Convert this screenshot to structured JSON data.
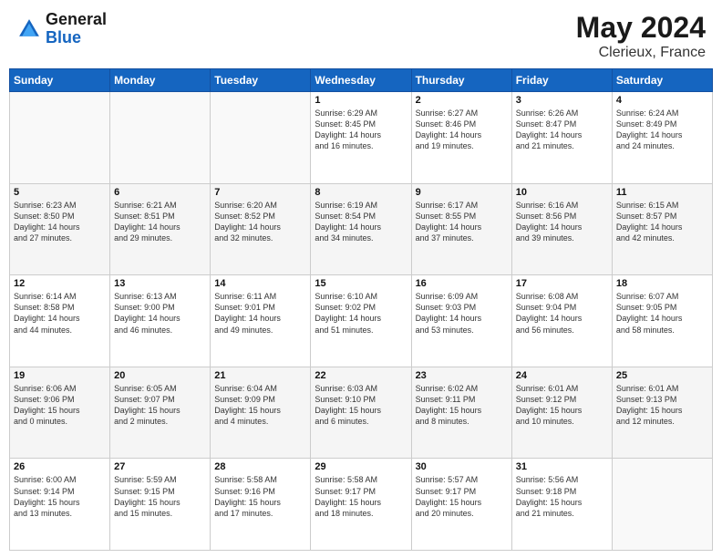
{
  "header": {
    "logo_general": "General",
    "logo_blue": "Blue",
    "month": "May 2024",
    "location": "Clerieux, France"
  },
  "weekdays": [
    "Sunday",
    "Monday",
    "Tuesday",
    "Wednesday",
    "Thursday",
    "Friday",
    "Saturday"
  ],
  "rows": [
    [
      {
        "day": "",
        "text": ""
      },
      {
        "day": "",
        "text": ""
      },
      {
        "day": "",
        "text": ""
      },
      {
        "day": "1",
        "text": "Sunrise: 6:29 AM\nSunset: 8:45 PM\nDaylight: 14 hours\nand 16 minutes."
      },
      {
        "day": "2",
        "text": "Sunrise: 6:27 AM\nSunset: 8:46 PM\nDaylight: 14 hours\nand 19 minutes."
      },
      {
        "day": "3",
        "text": "Sunrise: 6:26 AM\nSunset: 8:47 PM\nDaylight: 14 hours\nand 21 minutes."
      },
      {
        "day": "4",
        "text": "Sunrise: 6:24 AM\nSunset: 8:49 PM\nDaylight: 14 hours\nand 24 minutes."
      }
    ],
    [
      {
        "day": "5",
        "text": "Sunrise: 6:23 AM\nSunset: 8:50 PM\nDaylight: 14 hours\nand 27 minutes."
      },
      {
        "day": "6",
        "text": "Sunrise: 6:21 AM\nSunset: 8:51 PM\nDaylight: 14 hours\nand 29 minutes."
      },
      {
        "day": "7",
        "text": "Sunrise: 6:20 AM\nSunset: 8:52 PM\nDaylight: 14 hours\nand 32 minutes."
      },
      {
        "day": "8",
        "text": "Sunrise: 6:19 AM\nSunset: 8:54 PM\nDaylight: 14 hours\nand 34 minutes."
      },
      {
        "day": "9",
        "text": "Sunrise: 6:17 AM\nSunset: 8:55 PM\nDaylight: 14 hours\nand 37 minutes."
      },
      {
        "day": "10",
        "text": "Sunrise: 6:16 AM\nSunset: 8:56 PM\nDaylight: 14 hours\nand 39 minutes."
      },
      {
        "day": "11",
        "text": "Sunrise: 6:15 AM\nSunset: 8:57 PM\nDaylight: 14 hours\nand 42 minutes."
      }
    ],
    [
      {
        "day": "12",
        "text": "Sunrise: 6:14 AM\nSunset: 8:58 PM\nDaylight: 14 hours\nand 44 minutes."
      },
      {
        "day": "13",
        "text": "Sunrise: 6:13 AM\nSunset: 9:00 PM\nDaylight: 14 hours\nand 46 minutes."
      },
      {
        "day": "14",
        "text": "Sunrise: 6:11 AM\nSunset: 9:01 PM\nDaylight: 14 hours\nand 49 minutes."
      },
      {
        "day": "15",
        "text": "Sunrise: 6:10 AM\nSunset: 9:02 PM\nDaylight: 14 hours\nand 51 minutes."
      },
      {
        "day": "16",
        "text": "Sunrise: 6:09 AM\nSunset: 9:03 PM\nDaylight: 14 hours\nand 53 minutes."
      },
      {
        "day": "17",
        "text": "Sunrise: 6:08 AM\nSunset: 9:04 PM\nDaylight: 14 hours\nand 56 minutes."
      },
      {
        "day": "18",
        "text": "Sunrise: 6:07 AM\nSunset: 9:05 PM\nDaylight: 14 hours\nand 58 minutes."
      }
    ],
    [
      {
        "day": "19",
        "text": "Sunrise: 6:06 AM\nSunset: 9:06 PM\nDaylight: 15 hours\nand 0 minutes."
      },
      {
        "day": "20",
        "text": "Sunrise: 6:05 AM\nSunset: 9:07 PM\nDaylight: 15 hours\nand 2 minutes."
      },
      {
        "day": "21",
        "text": "Sunrise: 6:04 AM\nSunset: 9:09 PM\nDaylight: 15 hours\nand 4 minutes."
      },
      {
        "day": "22",
        "text": "Sunrise: 6:03 AM\nSunset: 9:10 PM\nDaylight: 15 hours\nand 6 minutes."
      },
      {
        "day": "23",
        "text": "Sunrise: 6:02 AM\nSunset: 9:11 PM\nDaylight: 15 hours\nand 8 minutes."
      },
      {
        "day": "24",
        "text": "Sunrise: 6:01 AM\nSunset: 9:12 PM\nDaylight: 15 hours\nand 10 minutes."
      },
      {
        "day": "25",
        "text": "Sunrise: 6:01 AM\nSunset: 9:13 PM\nDaylight: 15 hours\nand 12 minutes."
      }
    ],
    [
      {
        "day": "26",
        "text": "Sunrise: 6:00 AM\nSunset: 9:14 PM\nDaylight: 15 hours\nand 13 minutes."
      },
      {
        "day": "27",
        "text": "Sunrise: 5:59 AM\nSunset: 9:15 PM\nDaylight: 15 hours\nand 15 minutes."
      },
      {
        "day": "28",
        "text": "Sunrise: 5:58 AM\nSunset: 9:16 PM\nDaylight: 15 hours\nand 17 minutes."
      },
      {
        "day": "29",
        "text": "Sunrise: 5:58 AM\nSunset: 9:17 PM\nDaylight: 15 hours\nand 18 minutes."
      },
      {
        "day": "30",
        "text": "Sunrise: 5:57 AM\nSunset: 9:17 PM\nDaylight: 15 hours\nand 20 minutes."
      },
      {
        "day": "31",
        "text": "Sunrise: 5:56 AM\nSunset: 9:18 PM\nDaylight: 15 hours\nand 21 minutes."
      },
      {
        "day": "",
        "text": ""
      }
    ]
  ]
}
